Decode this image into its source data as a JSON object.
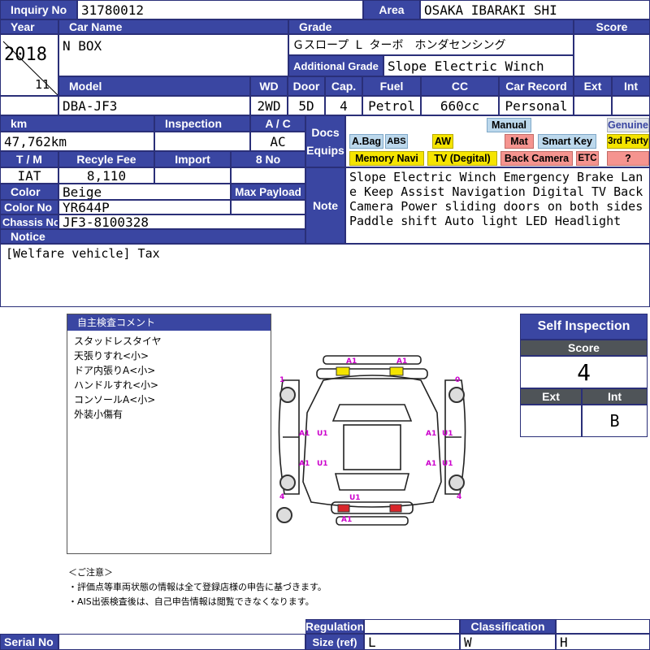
{
  "labels": {
    "inquiry": "Inquiry No",
    "area": "Area",
    "year": "Year",
    "car_name": "Car Name",
    "grade": "Grade",
    "score": "Score",
    "additional_grade": "Additional Grade",
    "model": "Model",
    "wd": "WD",
    "door": "Door",
    "cap": "Cap.",
    "fuel": "Fuel",
    "cc": "CC",
    "car_record": "Car Record",
    "ext": "Ext",
    "int": "Int",
    "km": "km",
    "inspection": "Inspection",
    "ac": "A / C",
    "docs": "Docs",
    "equips": "Equips",
    "tm": "T / M",
    "recycle_fee": "Recyle Fee",
    "import": "Import",
    "eight_no": "8 No",
    "color": "Color",
    "max_payload": "Max Payload",
    "color_no": "Color No",
    "note": "Note",
    "chassis_no": "Chassis No",
    "notice": "Notice",
    "regulation": "Regulation",
    "size": "Size (ref)",
    "classification": "Classification",
    "serial_no": "Serial No"
  },
  "values": {
    "inquiry_no": "31780012",
    "area": "OSAKA IBARAKI SHI",
    "year": "2018",
    "month": "11",
    "car_name": "N BOX",
    "grade": "Ｇスロープ L ターボ　ホンダセンシング",
    "additional_grade": "Slope Electric Winch",
    "model": "DBA-JF3",
    "wd": "2WD",
    "door": "5D",
    "cap": "4",
    "fuel": "Petrol",
    "cc": "660cc",
    "car_record": "Personal",
    "ext": "",
    "int": "",
    "score": "",
    "km": "47,762km",
    "inspection": "",
    "ac": "AC",
    "tm": "IAT",
    "recycle_fee": "8,110",
    "import": "",
    "eight_no": "",
    "color": "Beige",
    "max_payload": "",
    "color_no": "YR644P",
    "chassis_no": "JF3-8100328",
    "note": "Slope Electric Winch Emergency Brake Lane Keep Assist Navigation Digital TV Back Camera Power sliding doors on both sides Paddle shift Auto light LED Headlight",
    "notice": "[Welfare vehicle] Tax"
  },
  "equips": {
    "manual": "Manual",
    "genuine": "Genuine",
    "abag": "A.Bag",
    "abs": "ABS",
    "aw": "AW",
    "mat": "Mat",
    "smart_key": "Smart Key",
    "third_party": "3rd Party",
    "memory_navi": "Memory Navi",
    "tv_digital": "TV (Degital)",
    "back_camera": "Back Camera",
    "etc": "ETC",
    "question": "?"
  },
  "comment": {
    "title": "自主検査コメント",
    "lines": [
      "スタッドレスタイヤ",
      "天張りすれ<小>",
      "ドア内張りA<小>",
      "ハンドルすれ<小>",
      "コンソールA<小>",
      "外装小傷有"
    ]
  },
  "diagram": {
    "marks": [
      "A1",
      "A1",
      "1",
      "0",
      "A1",
      "U1",
      "A1",
      "U1",
      "A1",
      "U1",
      "A1",
      "U1",
      "4",
      "4",
      "U1",
      "A1"
    ]
  },
  "self_inspection": {
    "title": "Self Inspection",
    "score_label": "Score",
    "score": "4",
    "ext_label": "Ext",
    "int_label": "Int",
    "ext": "",
    "int": "B"
  },
  "footer_notes": [
    "＜ご注意＞",
    "・評価点等車両状態の情報は全て登録店様の申告に基づきます。",
    "・AIS出張検査後は、自己申告情報は閲覧できなくなります。"
  ],
  "bottom": {
    "size_l": "L",
    "class_w": "W",
    "class_h": "H",
    "serial_no": "",
    "regulation": ""
  },
  "colors": {
    "header": "#3a46a2",
    "mark": "#cc00cc",
    "yellow": "#f5e400",
    "red": "#d9252a"
  }
}
